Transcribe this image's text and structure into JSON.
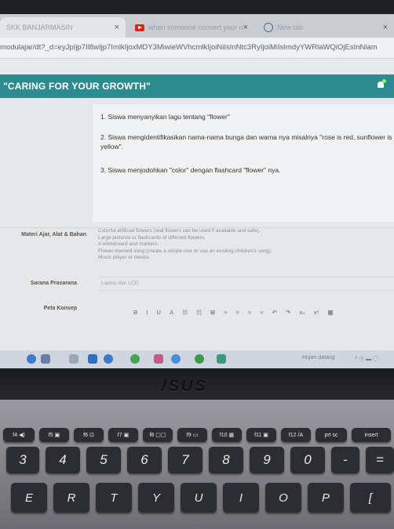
{
  "browser": {
    "tabs": [
      {
        "label": "SKK BANJARMASIN",
        "close": "×"
      },
      {
        "label": "when someone convert your n",
        "close": "×"
      },
      {
        "label": "New tab",
        "close": "×"
      }
    ],
    "url": "modulajar/dt?_d=eyJpIjp7Il8wIjp7ImlkIjoxMDY3MiwieWVhcmlkIjoiNiIsInNtc3RyIjoiMiIsImdyYWRlaWQiOjEsInNiam"
  },
  "app": {
    "title": "\"CARING FOR YOUR GROWTH\""
  },
  "objectives": [
    "1. Siswa menyanyikan lagu tentang \"flower\"",
    "2. Siswa mengidentifikasikan nama-nama bunga dan warna nya misalnya \"rose is red, sunflower is yellow\".",
    "3. Siswa menjodohkan \"color\" dengan flashcard \"flower\" nya."
  ],
  "materi": {
    "label": "Materi Ajar, Alat & Bahan",
    "lines": [
      "Colorful artificial flowers (real flowers can be used if available and safe).",
      "Large pictures or flashcards of different flowers.",
      "A whiteboard and markers.",
      "Flower-themed song (create a simple one or use an existing children's song).",
      "Music player or device."
    ]
  },
  "sarana": {
    "label": "Sarana Prasarana",
    "value": "Laptop dan LCD"
  },
  "peta": {
    "label": "Peta Konsep"
  },
  "toolbar": [
    "B",
    "I",
    "U",
    "A",
    "☷",
    "☷",
    "⊞",
    "≡",
    "≡",
    "≡",
    "≡",
    "↶",
    "↷",
    "x₂",
    "x²",
    "▦"
  ],
  "taskbar": {
    "weather": "Hujan datang",
    "tray": "^ ⓔ ▬ ◯"
  },
  "laptop": {
    "logo": "/SUS"
  },
  "keyboard": {
    "fn_row": [
      "f4 ◀)",
      "f5 ▣",
      "f6 ⊡",
      "f7 ▣",
      "f8 ▢▢",
      "f9 ▭",
      "f10 ▦",
      "f11 ▣",
      "f12 /A",
      "prt sc",
      "insert"
    ],
    "num_row": [
      "3",
      "4",
      "5",
      "6",
      "7",
      "8",
      "9",
      "0",
      "-",
      "="
    ],
    "letter_row": [
      "E",
      "R",
      "T",
      "Y",
      "U",
      "I",
      "O",
      "P",
      "["
    ]
  },
  "colors": {
    "header": "#2e8b8f",
    "taskbar": "#cfd6df",
    "keys": "#2c2d33"
  }
}
